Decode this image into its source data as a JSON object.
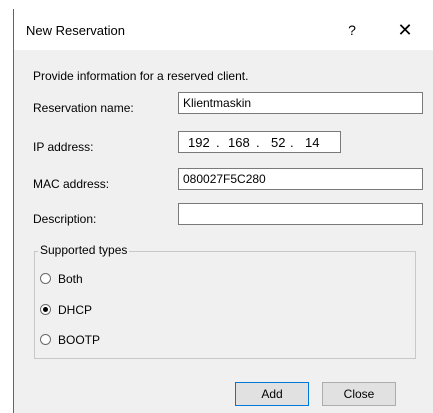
{
  "dialog": {
    "title": "New Reservation",
    "help_label": "?",
    "close_label": "✕",
    "intro": "Provide information for a reserved client."
  },
  "form": {
    "reservation_name_label": "Reservation name:",
    "reservation_name_value": "Klientmaskin",
    "ip_label": "IP address:",
    "ip_octets": [
      "192",
      "168",
      "52",
      "14"
    ],
    "mac_label": "MAC address:",
    "mac_value": "080027F5C280",
    "description_label": "Description:",
    "description_value": ""
  },
  "supported_types": {
    "legend": "Supported types",
    "options": [
      {
        "label": "Both",
        "selected": false
      },
      {
        "label": "DHCP",
        "selected": true
      },
      {
        "label": "BOOTP",
        "selected": false
      }
    ]
  },
  "buttons": {
    "add_label": "Add",
    "close_label": "Close"
  },
  "colors": {
    "window_border": "#2b6fc4",
    "default_button_border": "#0078d7"
  }
}
